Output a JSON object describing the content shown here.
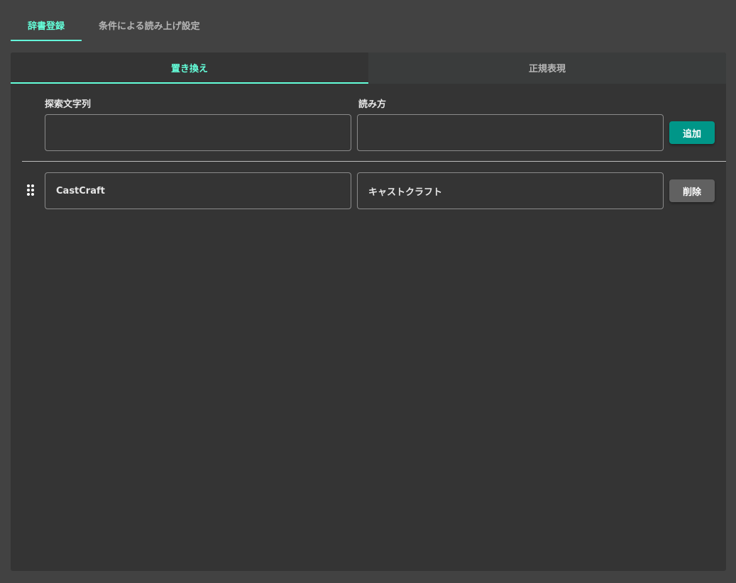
{
  "top_tabs": [
    {
      "label": "辞書登録",
      "active": true
    },
    {
      "label": "条件による読み上げ設定",
      "active": false
    }
  ],
  "sub_tabs": [
    {
      "label": "置き換え",
      "active": true
    },
    {
      "label": "正規表現",
      "active": false
    }
  ],
  "form": {
    "search_label": "探索文字列",
    "reading_label": "読み方",
    "search_value": "",
    "reading_value": "",
    "add_button": "追加"
  },
  "entries": [
    {
      "search": "CastCraft",
      "reading": "キャストクラフト",
      "delete_button": "削除"
    }
  ],
  "colors": {
    "accent": "#64ffda",
    "add_button": "#009688",
    "delete_button": "#616161",
    "background": "#424242",
    "panel": "#343434"
  }
}
